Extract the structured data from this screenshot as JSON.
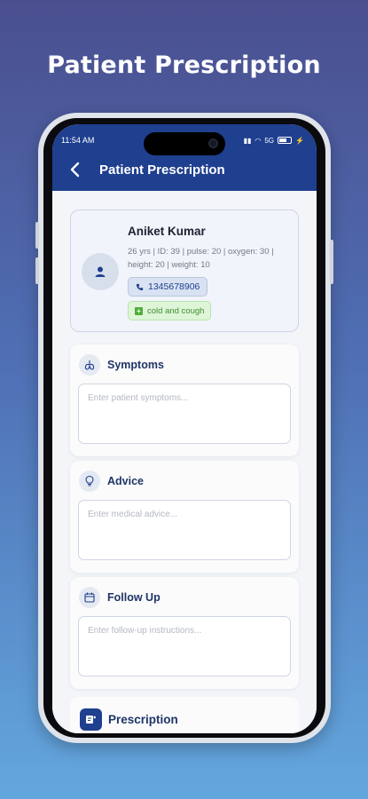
{
  "promo": {
    "title": "Patient Prescription"
  },
  "status_bar": {
    "time": "11:54 AM",
    "indicators": "5G",
    "battery": "75"
  },
  "header": {
    "title": "Patient Prescription"
  },
  "patient": {
    "name": "Aniket Kumar",
    "meta": "26 yrs | ID: 39  | pulse: 20 | oxygen: 30 | height: 20 | weight: 10",
    "phone": "1345678906",
    "condition": "cold and cough"
  },
  "sections": {
    "symptoms": {
      "title": "Symptoms",
      "placeholder": "Enter patient symptoms..."
    },
    "advice": {
      "title": "Advice",
      "placeholder": "Enter medical advice..."
    },
    "follow_up": {
      "title": "Follow Up",
      "placeholder": "Enter follow-up instructions..."
    },
    "prescription": {
      "title": "Prescription"
    }
  },
  "colors": {
    "header": "#1f3f8f",
    "accent_green": "#4fae3b",
    "title_text": "#1f3566"
  }
}
